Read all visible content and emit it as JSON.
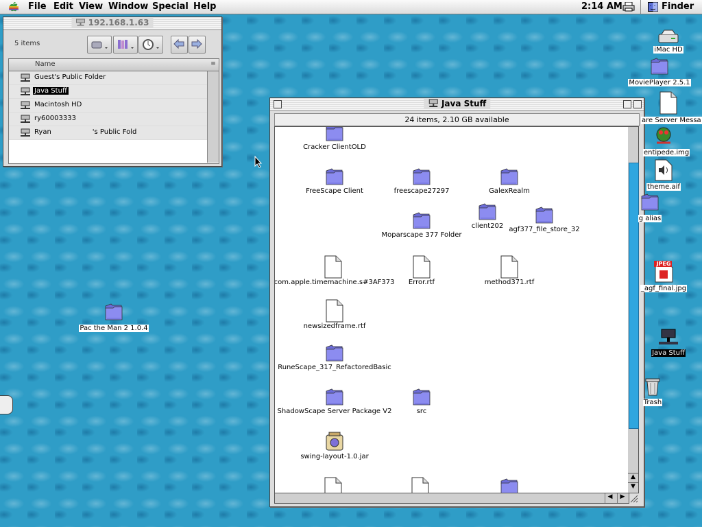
{
  "menubar": {
    "items": [
      "File",
      "Edit",
      "View",
      "Window",
      "Special",
      "Help"
    ],
    "clock": "2:14 AM",
    "app": "Finder"
  },
  "network_window": {
    "title": "192.168.1.63",
    "count": "5 items",
    "column": "Name",
    "rows": [
      {
        "label": "Guest's Public Folder",
        "selected": false
      },
      {
        "label": "Java Stuff",
        "selected": true
      },
      {
        "label": "Macintosh HD",
        "selected": false
      },
      {
        "label": "ry60003333",
        "selected": false
      },
      {
        "label": "Ryan      's Public Fold",
        "selected": false
      }
    ]
  },
  "java_window": {
    "title": "Java Stuff",
    "info": "24 items, 2.10 GB available",
    "files": [
      {
        "name": "Cracker ClientOLD",
        "kind": "folder"
      },
      {
        "name": "FreeScape Client",
        "kind": "folder"
      },
      {
        "name": "freescape27297",
        "kind": "folder"
      },
      {
        "name": "GalexRealm",
        "kind": "folder"
      },
      {
        "name": "client202",
        "kind": "folder"
      },
      {
        "name": "agf377_file_store_32",
        "kind": "folder"
      },
      {
        "name": "Moparscape 377 Folder",
        "kind": "folder"
      },
      {
        "name": ".com.apple.timemachine.s#3AF373",
        "kind": "doc"
      },
      {
        "name": "Error.rtf",
        "kind": "doc"
      },
      {
        "name": "method371.rtf",
        "kind": "doc"
      },
      {
        "name": "newsizedframe.rtf",
        "kind": "doc"
      },
      {
        "name": "RuneScape_317_RefactoredBasic",
        "kind": "folder"
      },
      {
        "name": "ShadowScape Server Package V2",
        "kind": "folder"
      },
      {
        "name": "src",
        "kind": "folder"
      },
      {
        "name": "swing-layout-1.0.jar",
        "kind": "jar"
      }
    ]
  },
  "desktop": {
    "icons": [
      {
        "name": "iMac HD"
      },
      {
        "name": "MoviePlayer 2.5.1"
      },
      {
        "name": "are Server Messa"
      },
      {
        "name": "entipede.img"
      },
      {
        "name": "theme.aif"
      },
      {
        "name": "g alias"
      },
      {
        "name": "_agf_final.jpg"
      },
      {
        "name": "Java Stuff"
      },
      {
        "name": "Trash"
      },
      {
        "name": "Pac the Man 2 1.0.4"
      }
    ],
    "jpeg_badge": "JPEG"
  },
  "colors": {
    "desktop": "#2f9dc7",
    "folder": "#8c8cf0",
    "scroll_thumb": "#2fa6df",
    "selection": "#000000"
  }
}
